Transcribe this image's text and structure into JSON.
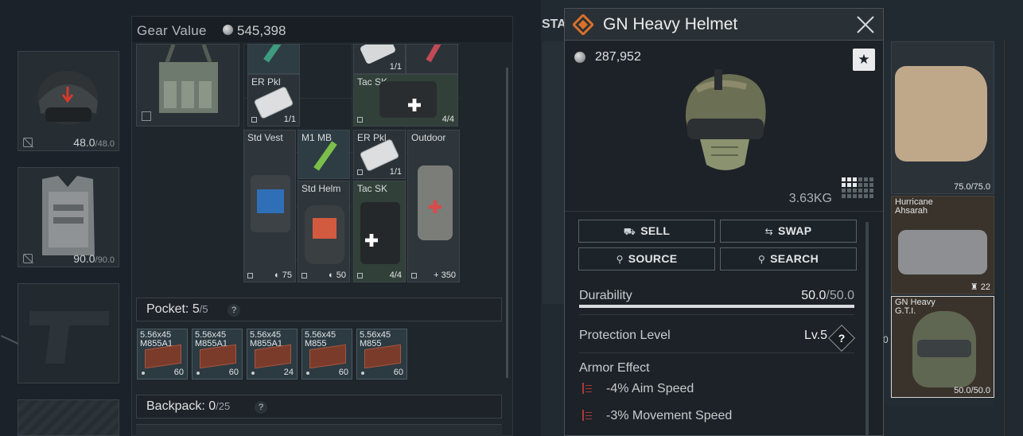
{
  "equipment": {
    "helmet_durability": "48.0",
    "helmet_durability_max": "/48.0",
    "armor_durability": "90.0",
    "armor_durability_max": "/90.0"
  },
  "gear_value": {
    "label": "Gear Value",
    "value": "545,398"
  },
  "rig_items": [
    {
      "name": "",
      "qty": "1/1"
    },
    {
      "name": "ER Pkl",
      "qty": "1/1"
    },
    {
      "name": "Tac SK",
      "qty": "4/4"
    },
    {
      "name": "Std Vest",
      "qty": "75"
    },
    {
      "name": "M1 MB",
      "qty": ""
    },
    {
      "name": "ER Pkl",
      "qty": "1/1"
    },
    {
      "name": "Outdoor",
      "qty": "350"
    },
    {
      "name": "Std Helm",
      "qty": "50"
    },
    {
      "name": "Tac SK",
      "qty": "4/4"
    }
  ],
  "pocket": {
    "label": "Pocket:",
    "count": "5",
    "max": "/5",
    "help": "?",
    "items": [
      {
        "name": "5.56x45 M855A1",
        "qty": "60"
      },
      {
        "name": "5.56x45 M855A1",
        "qty": "60"
      },
      {
        "name": "5.56x45 M855A1",
        "qty": "24"
      },
      {
        "name": "5.56x45 M855",
        "qty": "60"
      },
      {
        "name": "5.56x45 M855",
        "qty": "60"
      }
    ]
  },
  "backpack": {
    "label": "Backpack:",
    "count": "0",
    "max": "/25",
    "help": "?"
  },
  "stash": {
    "label": "STA"
  },
  "tooltip": {
    "title": "GN Heavy Helmet",
    "price": "287,952",
    "weight": "3.63KG",
    "buttons": {
      "sell": "SELL",
      "swap": "SWAP",
      "source": "SOURCE",
      "search": "SEARCH"
    },
    "durability_label": "Durability",
    "durability_value": "50.0",
    "durability_max": "/50.0",
    "durability_fraction": 1.0,
    "protection_label": "Protection Level",
    "protection_value": "Lv.5",
    "protection_help": "?",
    "armor_effect_label": "Armor Effect",
    "effects": [
      "-4% Aim Speed",
      "-3% Movement Speed"
    ],
    "colors": {
      "logo": "#d9702a",
      "effect_icon": "#a83b38"
    }
  },
  "right_panel": {
    "armor_top_durability": "75.0/75.0",
    "hurricane_name": "Hurricane Ahsarah",
    "hurricane_qty": "22",
    "helmet_name": "GN Heavy G.T.I.",
    "helmet_durability": "50.0/50.0",
    "edge_digit": "0"
  }
}
